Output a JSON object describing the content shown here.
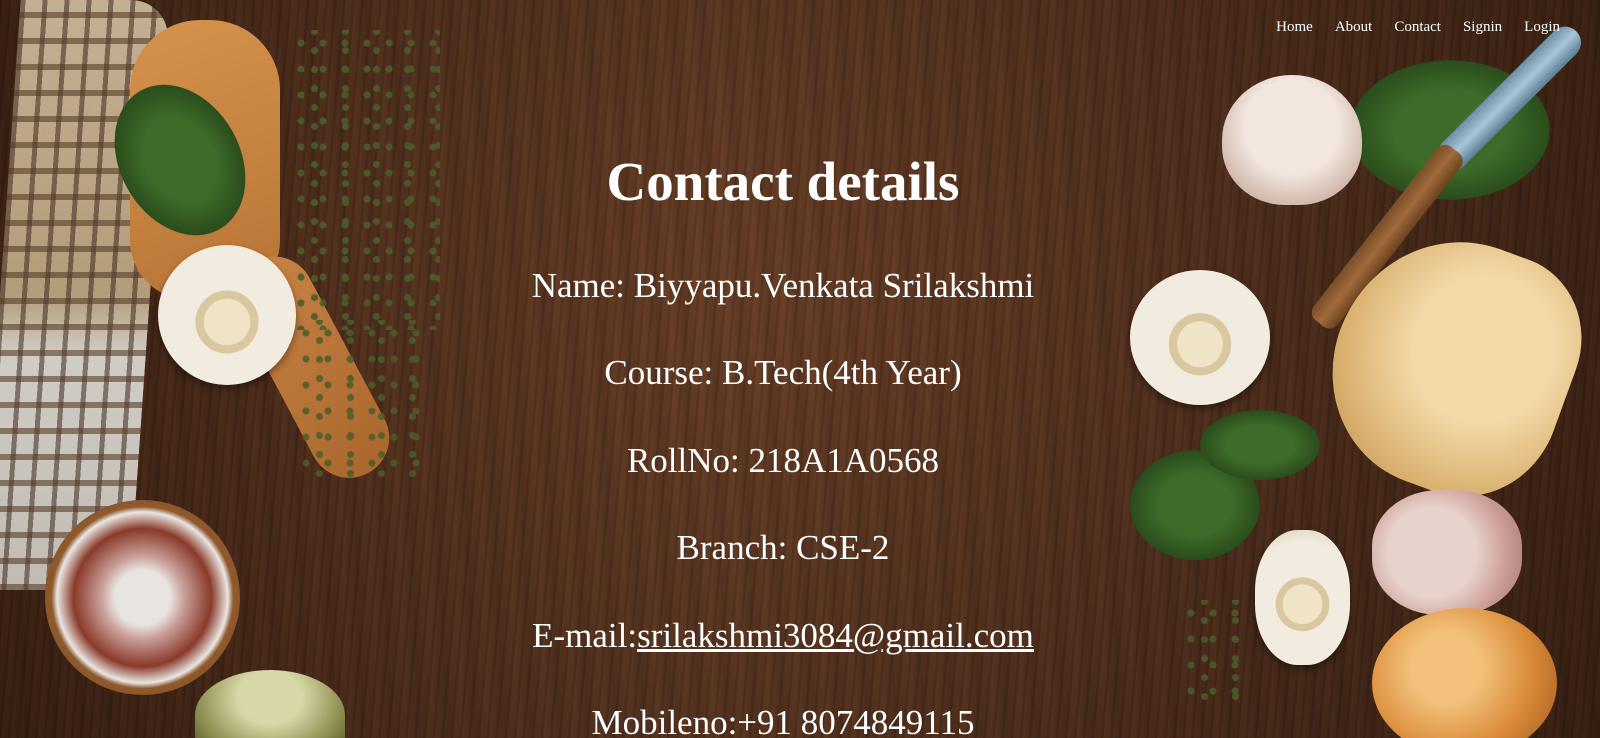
{
  "nav": {
    "items": [
      "Home",
      "About",
      "Contact",
      "Signin",
      "Login"
    ]
  },
  "main": {
    "title": "Contact details",
    "name_line": "Name: Biyyapu.Venkata Srilakshmi",
    "course_line": "Course: B.Tech(4th Year)",
    "rollno_line": "RollNo: 218A1A0568",
    "branch_line": "Branch: CSE-2",
    "email_label": "E-mail:",
    "email_value": "srilakshmi3084@gmail.com",
    "mobile_line": "Mobileno:+91 8074849115"
  },
  "colors": {
    "text": "#ffffff",
    "background": "#5b3520"
  }
}
